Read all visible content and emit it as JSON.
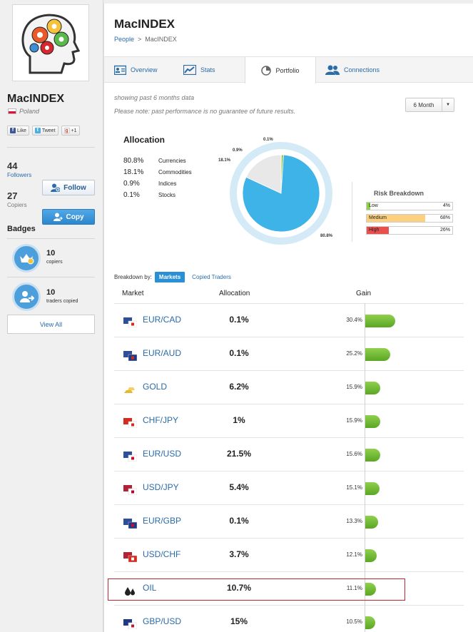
{
  "profile": {
    "name": "MacINDEX",
    "country": "Poland",
    "social": {
      "like": "Like",
      "tweet": "Tweet",
      "gplus": "+1"
    },
    "followers_count": "44",
    "followers_label": "Followers",
    "copiers_count": "27",
    "copiers_label": "Copiers",
    "follow_label": "Follow",
    "copy_label": "Copy",
    "badges_title": "Badges",
    "badges": [
      {
        "count": "10",
        "label": "copiers"
      },
      {
        "count": "10",
        "label": "traders copied"
      }
    ],
    "view_all_label": "View All"
  },
  "header": {
    "title": "MacINDEX",
    "breadcrumb": {
      "root": "People",
      "sep": ">",
      "current": "MacINDEX"
    }
  },
  "tabs": [
    {
      "label": "Overview",
      "icon": "overview-icon"
    },
    {
      "label": "Stats",
      "icon": "chart-line-icon"
    },
    {
      "label": "Portfolio",
      "icon": "pie-icon",
      "active": true
    },
    {
      "label": "Connections",
      "icon": "people-icon"
    }
  ],
  "portfolio": {
    "note_period": "showing past 6 months data",
    "note_disclaimer": "Please note: past performance is no guarantee of future results.",
    "range_value": "6 Month",
    "allocation_title": "Allocation",
    "allocation": [
      {
        "pct": "80.8%",
        "name": "Currencies",
        "value": 80.8
      },
      {
        "pct": "18.1%",
        "name": "Commodities",
        "value": 18.1
      },
      {
        "pct": "0.9%",
        "name": "Indices",
        "value": 0.9
      },
      {
        "pct": "0.1%",
        "name": "Stocks",
        "value": 0.1
      }
    ],
    "pie_labels": {
      "stocks": "0.1%",
      "indices": "0.9%",
      "commodities": "18.1%",
      "currencies": "80.8%"
    },
    "colors": {
      "currencies": "#3db3e8",
      "commodities": "#e8e8e8",
      "indices": "#8fc64a",
      "stocks": "#f5a623",
      "ring": "#d4ebf7",
      "gain_bar": "#6cb92f",
      "brand_blue": "#2a90d6"
    },
    "risk_title": "Risk Breakdown",
    "risk": [
      {
        "label": "Low",
        "pct": "4%",
        "value": 0.04,
        "color": "#8fd04e"
      },
      {
        "label": "Medium",
        "pct": "68%",
        "value": 0.68,
        "color": "#fcd07e"
      },
      {
        "label": "High",
        "pct": "26%",
        "value": 0.26,
        "color": "#e85050"
      }
    ],
    "breakdown_label": "Breakdown by:",
    "breakdown_tabs": [
      "Markets",
      "Copied Traders"
    ],
    "columns": {
      "market": "Market",
      "allocation": "Allocation",
      "gain": "Gain"
    },
    "rows": [
      {
        "market": "EUR/CAD",
        "allocation": "0.1%",
        "gain": "30.4%",
        "gain_value": 30.4
      },
      {
        "market": "EUR/AUD",
        "allocation": "0.1%",
        "gain": "25.2%",
        "gain_value": 25.2
      },
      {
        "market": "GOLD",
        "allocation": "6.2%",
        "gain": "15.9%",
        "gain_value": 15.9
      },
      {
        "market": "CHF/JPY",
        "allocation": "1%",
        "gain": "15.9%",
        "gain_value": 15.9
      },
      {
        "market": "EUR/USD",
        "allocation": "21.5%",
        "gain": "15.6%",
        "gain_value": 15.6
      },
      {
        "market": "USD/JPY",
        "allocation": "5.4%",
        "gain": "15.1%",
        "gain_value": 15.1
      },
      {
        "market": "EUR/GBP",
        "allocation": "0.1%",
        "gain": "13.3%",
        "gain_value": 13.3
      },
      {
        "market": "USD/CHF",
        "allocation": "3.7%",
        "gain": "12.1%",
        "gain_value": 12.1
      },
      {
        "market": "OIL",
        "allocation": "10.7%",
        "gain": "11.1%",
        "gain_value": 11.1
      },
      {
        "market": "GBP/USD",
        "allocation": "15%",
        "gain": "10.5%",
        "gain_value": 10.5
      }
    ]
  }
}
